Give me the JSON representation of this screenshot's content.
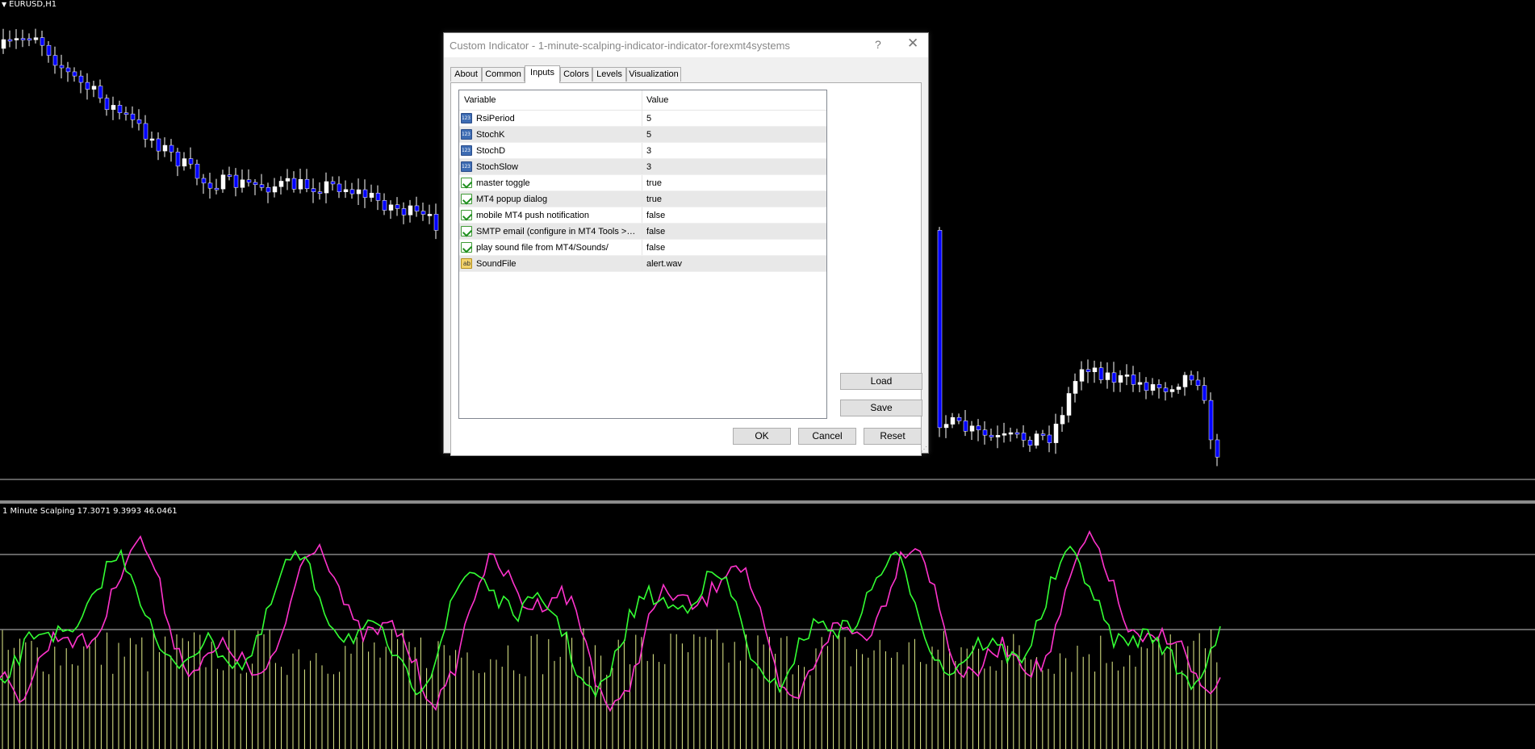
{
  "chart": {
    "symbol": "EURUSD,H1",
    "indicator_label": "1 Minute Scalping 17.3071 9.3993 46.0461"
  },
  "dialog": {
    "title": "Custom Indicator - 1-minute-scalping-indicator-indicator-forexmt4systems",
    "help": "?",
    "close": "✕",
    "tabs": [
      {
        "label": "About"
      },
      {
        "label": "Common"
      },
      {
        "label": "Inputs",
        "active": true
      },
      {
        "label": "Colors"
      },
      {
        "label": "Levels"
      },
      {
        "label": "Visualization"
      }
    ],
    "grid": {
      "col_variable": "Variable",
      "col_value": "Value",
      "rows": [
        {
          "variable": "RsiPeriod",
          "value": "5",
          "type": "int-icon"
        },
        {
          "variable": "StochK",
          "value": "5",
          "type": "int-icon"
        },
        {
          "variable": "StochD",
          "value": "3",
          "type": "int-icon"
        },
        {
          "variable": "StochSlow",
          "value": "3",
          "type": "int-icon"
        },
        {
          "variable": "master toggle",
          "value": "true",
          "type": "bool-icon"
        },
        {
          "variable": "MT4 popup dialog",
          "value": "true",
          "type": "bool-icon"
        },
        {
          "variable": "mobile MT4 push notification",
          "value": "false",
          "type": "bool-icon"
        },
        {
          "variable": "SMTP email (configure in MT4 Tools > O...",
          "value": "false",
          "type": "bool-icon"
        },
        {
          "variable": "play sound file from MT4/Sounds/",
          "value": "false",
          "type": "bool-icon"
        },
        {
          "variable": "SoundFile",
          "value": "alert.wav",
          "type": "string-icon"
        }
      ]
    },
    "buttons": {
      "load": "Load",
      "save": "Save",
      "ok": "OK",
      "cancel": "Cancel",
      "reset": "Reset"
    }
  },
  "colors": {
    "background": "#000000",
    "bull_candle": "#ffffff",
    "bear_candle": "#0000ff",
    "line_magenta": "#ff33cc",
    "line_green": "#33ff33",
    "histogram": "#e6f08c",
    "level_line": "#c8c8c8"
  }
}
